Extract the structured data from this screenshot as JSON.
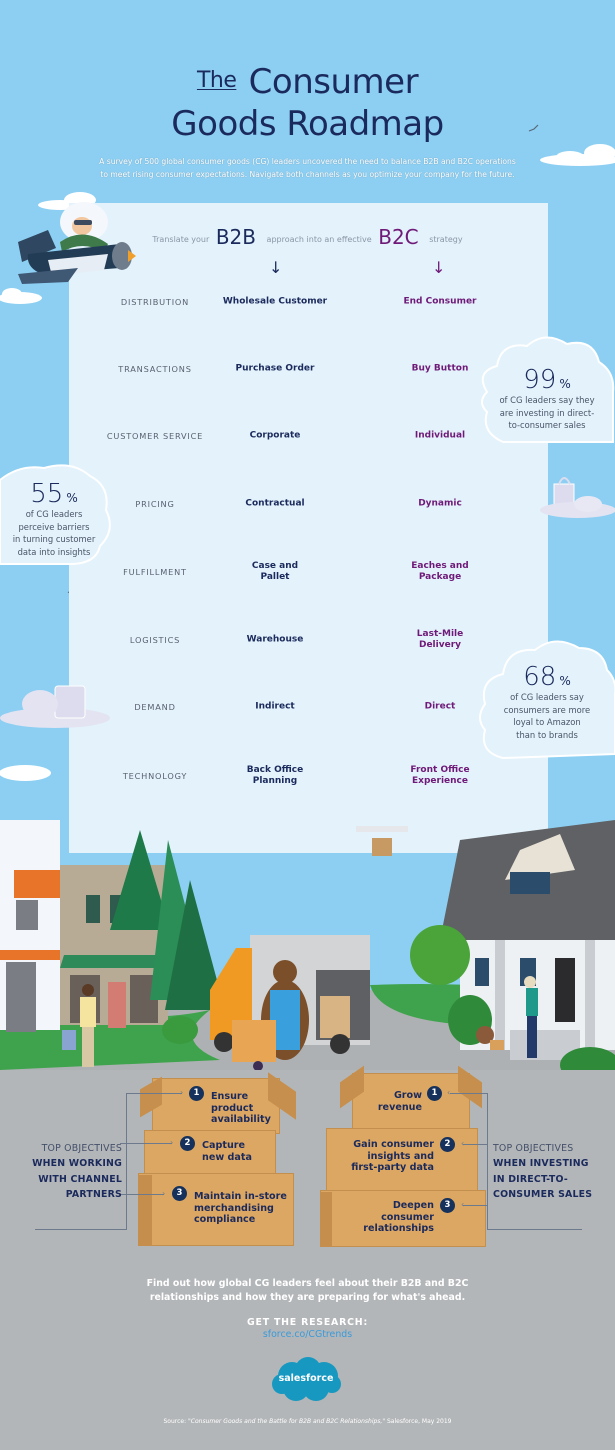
{
  "header": {
    "title_prefix": "The",
    "title_line1": "Consumer",
    "title_line2": "Goods Roadmap",
    "intro_line1": "A survey of 500 global consumer goods (CG) leaders uncovered the need to balance B2B and B2C operations",
    "intro_line2": "to meet rising consumer expectations. Navigate both channels as you optimize your company for the future."
  },
  "comparison": {
    "translate_prefix": "Translate your",
    "b2b_label": "B2B",
    "translate_middle": "approach into an effective",
    "b2c_label": "B2C",
    "translate_suffix": "strategy",
    "arrow_symbol": "↓",
    "rows": [
      {
        "category": "DISTRIBUTION",
        "b2b": "Wholesale Customer",
        "b2c": "End Consumer"
      },
      {
        "category": "TRANSACTIONS",
        "b2b": "Purchase Order",
        "b2c": "Buy Button"
      },
      {
        "category": "CUSTOMER SERVICE",
        "b2b": "Corporate",
        "b2c": "Individual"
      },
      {
        "category": "PRICING",
        "b2b": "Contractual",
        "b2c": "Dynamic"
      },
      {
        "category": "FULFILLMENT",
        "b2b": "Case and Pallet",
        "b2c": "Eaches and Package"
      },
      {
        "category": "LOGISTICS",
        "b2b": "Warehouse",
        "b2c": "Last-Mile Delivery"
      },
      {
        "category": "DEMAND",
        "b2b": "Indirect",
        "b2c": "Direct"
      },
      {
        "category": "TECHNOLOGY",
        "b2b": "Back Office Planning",
        "b2c": "Front Office Experience"
      }
    ]
  },
  "stats": [
    {
      "value": "99",
      "unit": "%",
      "line1": "of CG leaders say they",
      "line2": "are investing in direct-",
      "line3": "to-consumer sales",
      "line4": ""
    },
    {
      "value": "55",
      "unit": "%",
      "line1": "of CG leaders",
      "line2": "perceive barriers",
      "line3": "in turning customer",
      "line4": "data into insights"
    },
    {
      "value": "68",
      "unit": "%",
      "line1": "of CG leaders say",
      "line2": "consumers are more",
      "line3": "loyal to Amazon",
      "line4": "than to brands"
    }
  ],
  "objectives_b2b": {
    "title_top": "TOP OBJECTIVES",
    "title_line2": "WHEN WORKING",
    "title_line3": "WITH CHANNEL",
    "title_line4": "PARTNERS",
    "items": [
      {
        "number": "1",
        "line1": "Ensure",
        "line2": "product",
        "line3": "availability"
      },
      {
        "number": "2",
        "line1": "Capture",
        "line2": "new data",
        "line3": ""
      },
      {
        "number": "3",
        "line1": "Maintain in-store",
        "line2": "merchandising",
        "line3": "compliance"
      }
    ]
  },
  "objectives_b2c": {
    "title_top": "TOP OBJECTIVES",
    "title_line2": "WHEN INVESTING",
    "title_line3": "IN DIRECT-TO-",
    "title_line4": "CONSUMER SALES",
    "items": [
      {
        "number": "1",
        "line1": "Grow",
        "line2": "revenue",
        "line3": ""
      },
      {
        "number": "2",
        "line1": "Gain consumer",
        "line2": "insights and",
        "line3": "first-party data"
      },
      {
        "number": "3",
        "line1": "Deepen",
        "line2": "consumer",
        "line3": "relationships"
      }
    ]
  },
  "footer": {
    "cta_line1": "Find out how global CG leaders feel about their B2B and B2C",
    "cta_line2": "relationships and how they are preparing for what's ahead.",
    "get_research": "GET THE RESEARCH:",
    "link": "sforce.co/CGtrends",
    "logo_text": "salesforce",
    "source_prefix": "Source: ",
    "source_title": "\"Consumer Goods and the Battle for B2B and B2C Relationships,\"",
    "source_suffix": " Salesforce, May 2019"
  },
  "colors": {
    "sky": "#8ccff2",
    "panel": "#e3f2fb",
    "navy": "#1b2a5c",
    "purple": "#6f1a78",
    "ground": "#b3b6b8",
    "box": "#dca762",
    "salesforce_blue": "#1798c1",
    "link_blue": "#3a9ad9"
  }
}
